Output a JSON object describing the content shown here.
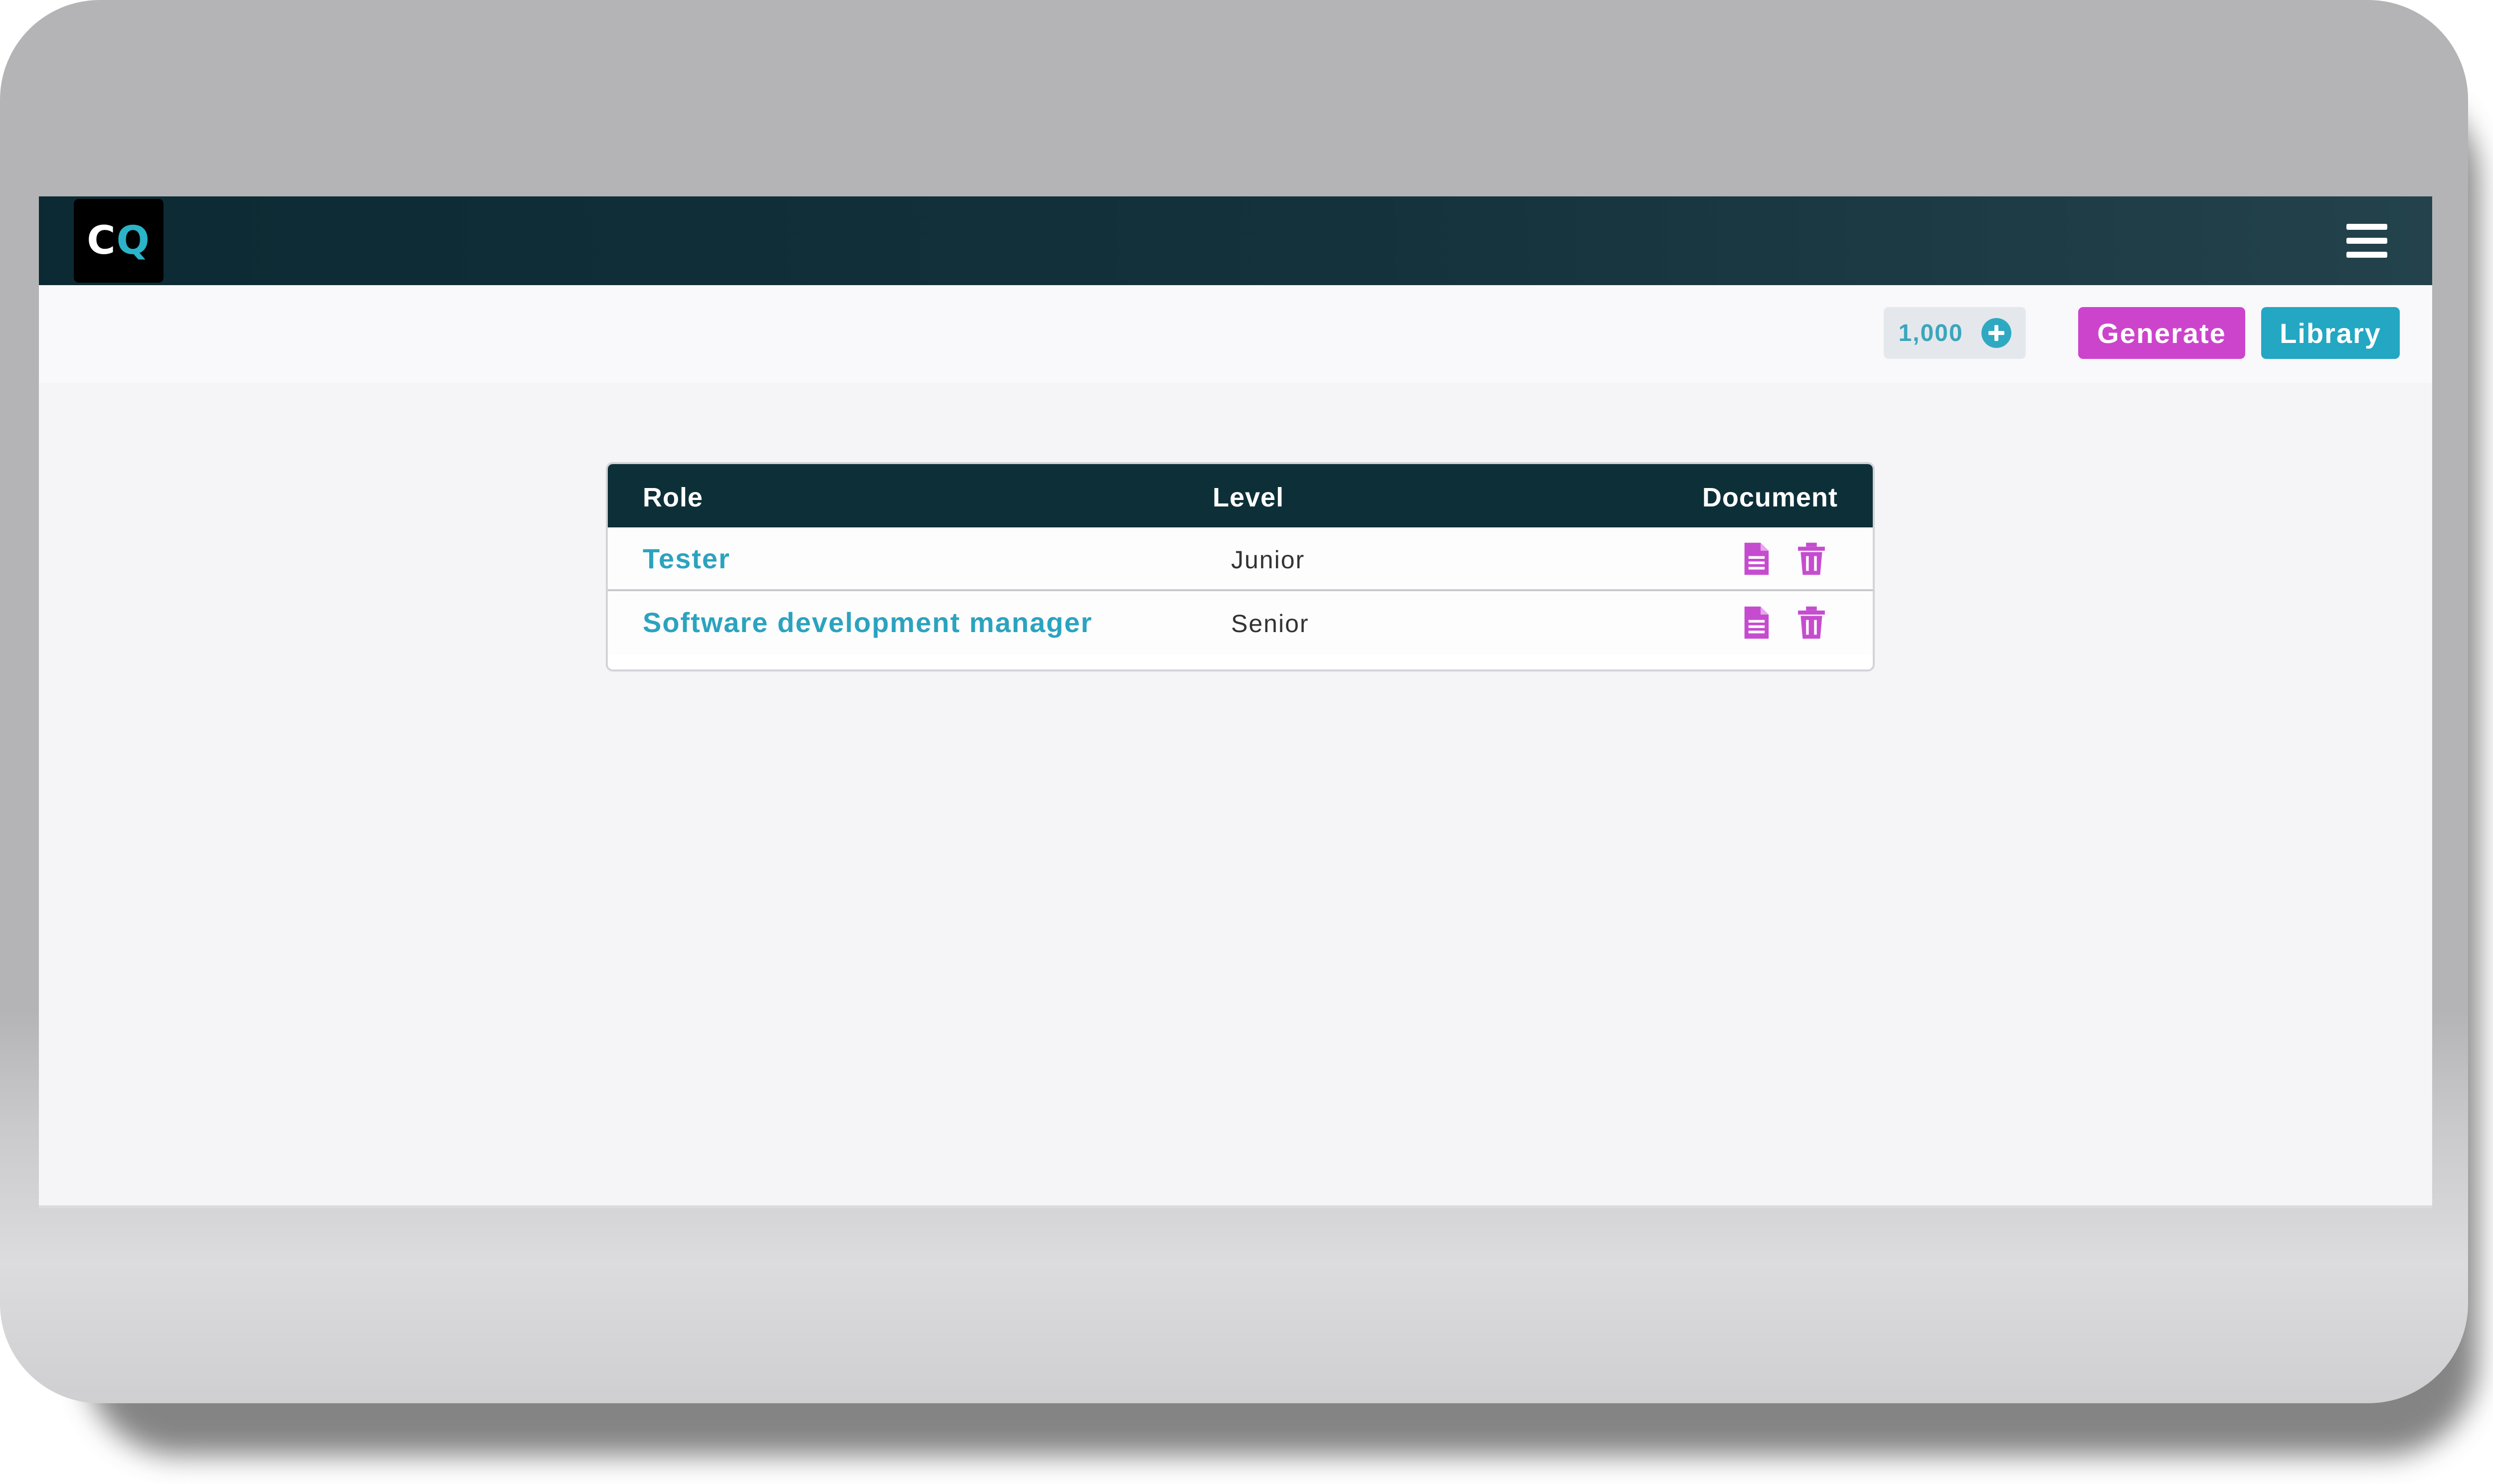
{
  "logo": {
    "letter_c": "C",
    "letter_q": "Q"
  },
  "toolbar": {
    "credits": "1,000",
    "generate_label": "Generate",
    "library_label": "Library"
  },
  "table": {
    "headers": {
      "role": "Role",
      "level": "Level",
      "document": "Document"
    },
    "rows": [
      {
        "role": "Tester",
        "level": "Junior"
      },
      {
        "role": "Software development manager",
        "level": "Senior"
      }
    ]
  },
  "icons": {
    "menu": "hamburger-menu-icon",
    "add_credits": "plus-circle-icon",
    "document": "document-icon",
    "delete": "trash-icon"
  },
  "colors": {
    "navbar": "#0d2f38",
    "accent_magenta": "#cc44cc",
    "accent_teal": "#23a7c2",
    "link": "#2ba3bf"
  }
}
